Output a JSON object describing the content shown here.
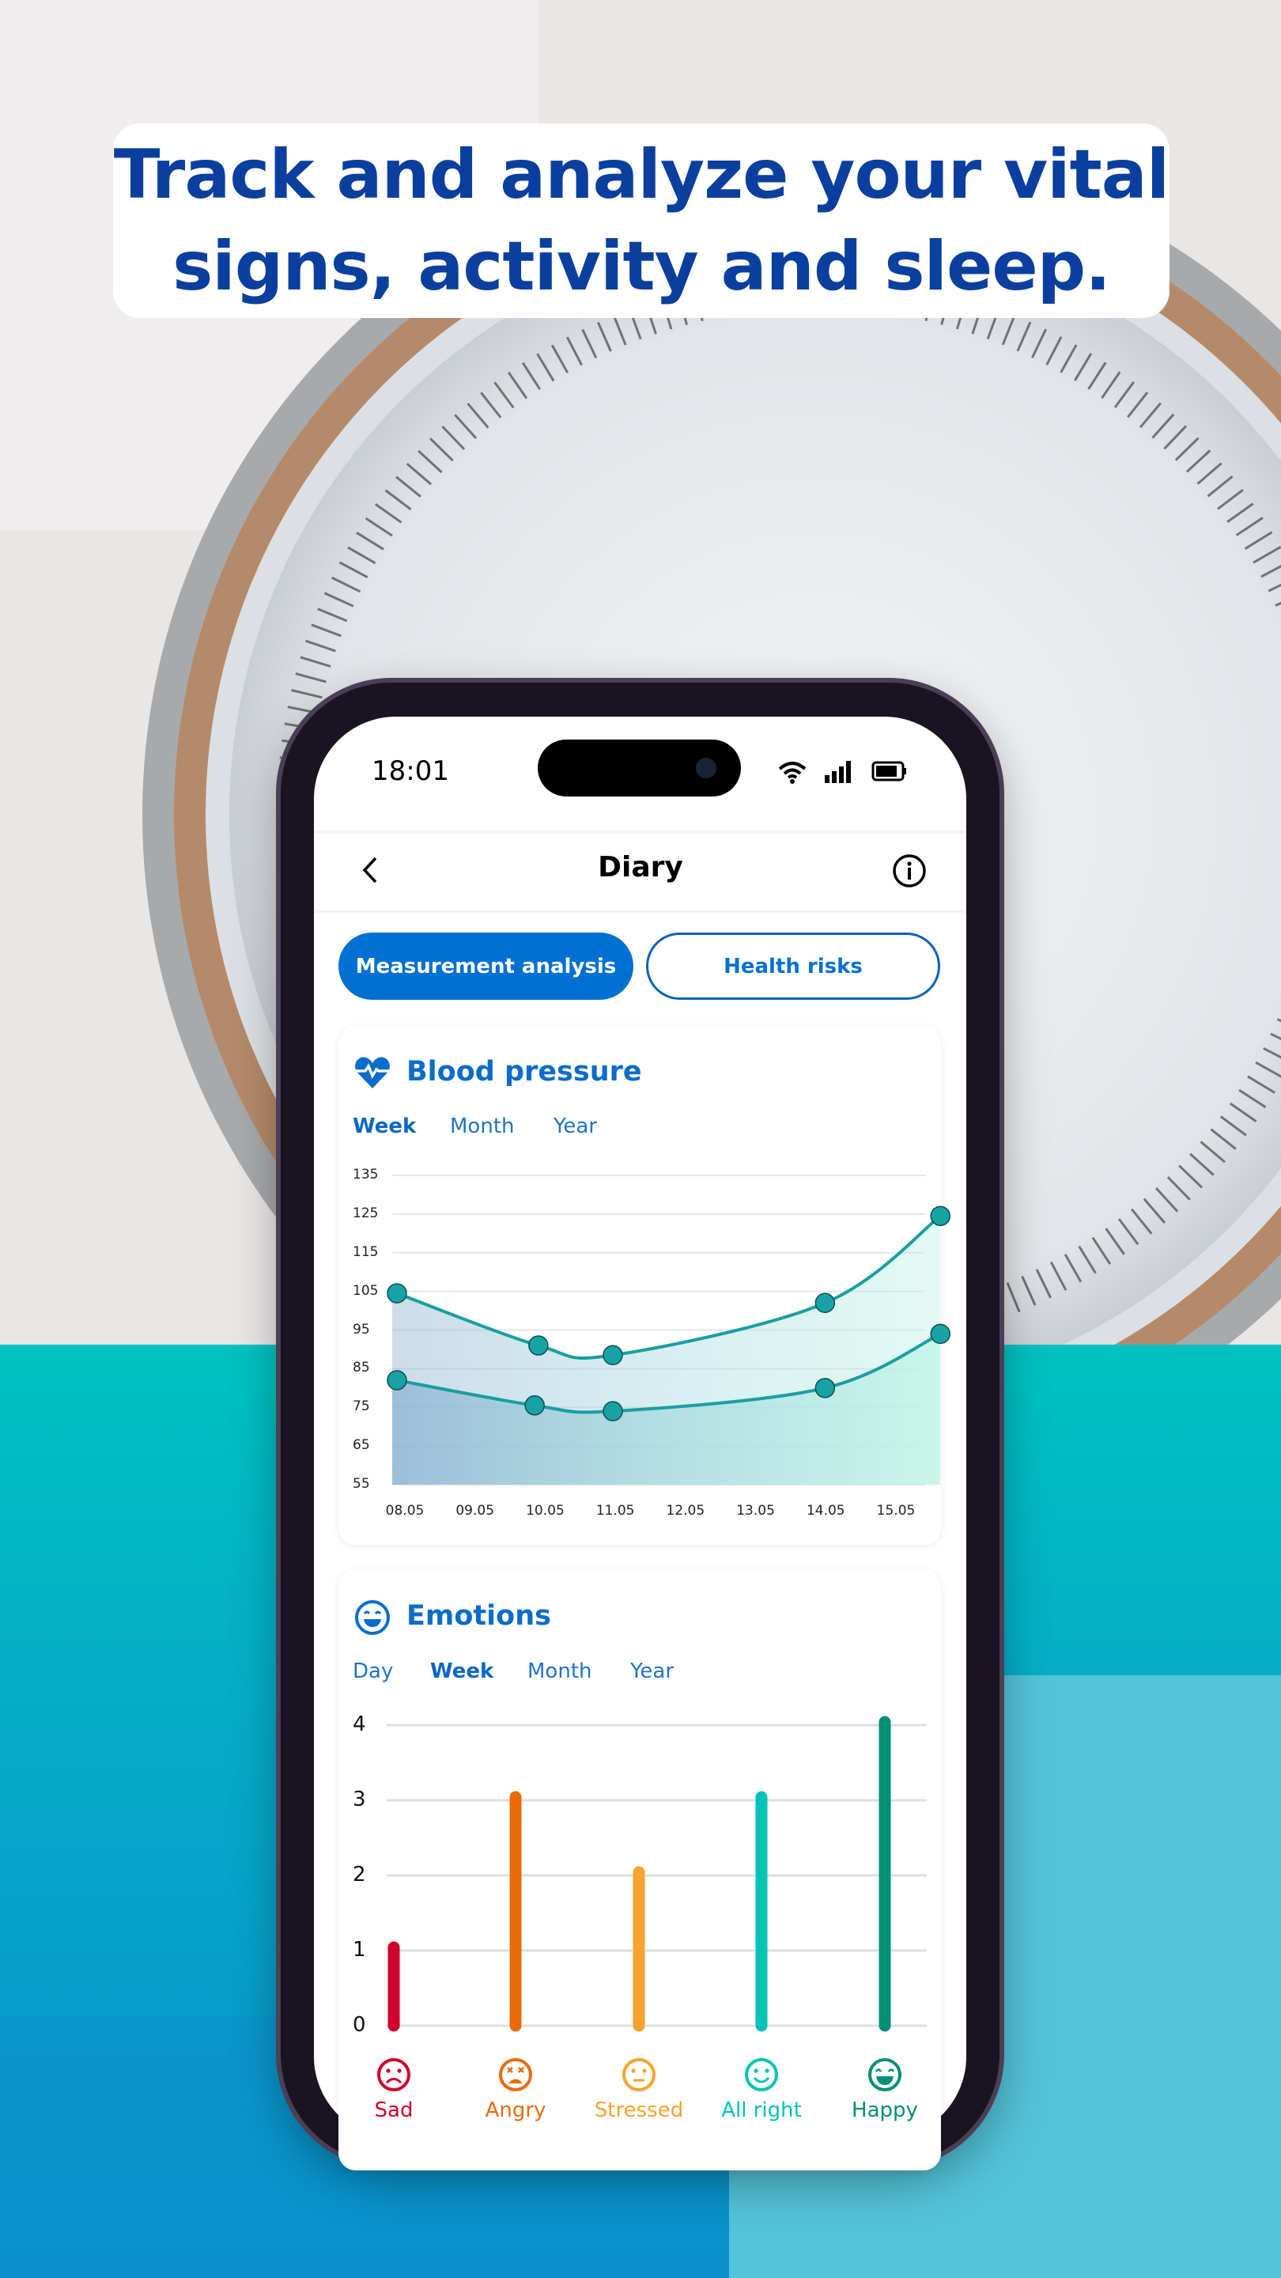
{
  "headline": "Track and analyze your vital signs, activity and sleep.",
  "status_bar": {
    "time": "18:01",
    "icons": [
      "wifi-icon",
      "signal-icon",
      "battery-icon"
    ]
  },
  "nav": {
    "title": "Diary",
    "back_icon": "chevron-left-icon",
    "info_icon": "info-icon"
  },
  "segments": [
    {
      "label": "Measurement analysis",
      "active": true
    },
    {
      "label": "Health risks",
      "active": false
    }
  ],
  "colors": {
    "primary": "#0070d2",
    "line": "#1a9ea0",
    "headline": "#0b3f9f"
  },
  "blood_pressure": {
    "title": "Blood pressure",
    "icon": "heart-pulse-icon",
    "tabs": [
      {
        "label": "Week",
        "selected": true
      },
      {
        "label": "Month",
        "selected": false
      },
      {
        "label": "Year",
        "selected": false
      }
    ]
  },
  "emotions": {
    "title": "Emotions",
    "icon": "smile-icon",
    "tabs": [
      {
        "label": "Day",
        "selected": false
      },
      {
        "label": "Week",
        "selected": true
      },
      {
        "label": "Month",
        "selected": false
      },
      {
        "label": "Year",
        "selected": false
      }
    ]
  },
  "chart_data": [
    {
      "type": "line",
      "title": "Blood pressure",
      "categories": [
        "08.05",
        "09.05",
        "10.05",
        "11.05",
        "12.05",
        "13.05",
        "14.05",
        "15.05"
      ],
      "yticks": [
        "135",
        "125",
        "115",
        "105",
        "95",
        "85",
        "75",
        "65",
        "55"
      ],
      "ylim": [
        55,
        135
      ],
      "grid": true,
      "series": [
        {
          "points": [
            {
              "x": 0,
              "y": 104.5
            },
            {
              "x": 1.9,
              "y": 91
            },
            {
              "x": 2.9,
              "y": 88.5
            },
            {
              "x": 5.75,
              "y": 102
            },
            {
              "x": 7.3,
              "y": 124.5
            }
          ]
        },
        {
          "points": [
            {
              "x": 0,
              "y": 82
            },
            {
              "x": 1.85,
              "y": 75.5
            },
            {
              "x": 2.9,
              "y": 74
            },
            {
              "x": 5.75,
              "y": 80
            },
            {
              "x": 7.3,
              "y": 94
            }
          ]
        }
      ]
    },
    {
      "type": "bar",
      "title": "Emotions",
      "categories": [
        "Sad",
        "Angry",
        "Stressed",
        "All right",
        "Happy"
      ],
      "values": [
        1,
        3,
        2,
        3,
        4
      ],
      "colors": [
        "#d0002c",
        "#ea6a0a",
        "#f9a22e",
        "#00c3b8",
        "#008f77"
      ],
      "icons": [
        "sad-face-icon",
        "angry-face-icon",
        "neutral-face-icon",
        "smile-face-icon",
        "happy-face-icon"
      ],
      "yticks": [
        "4",
        "3",
        "2",
        "1",
        "0"
      ],
      "ylim": [
        0,
        4
      ],
      "grid": true
    }
  ]
}
